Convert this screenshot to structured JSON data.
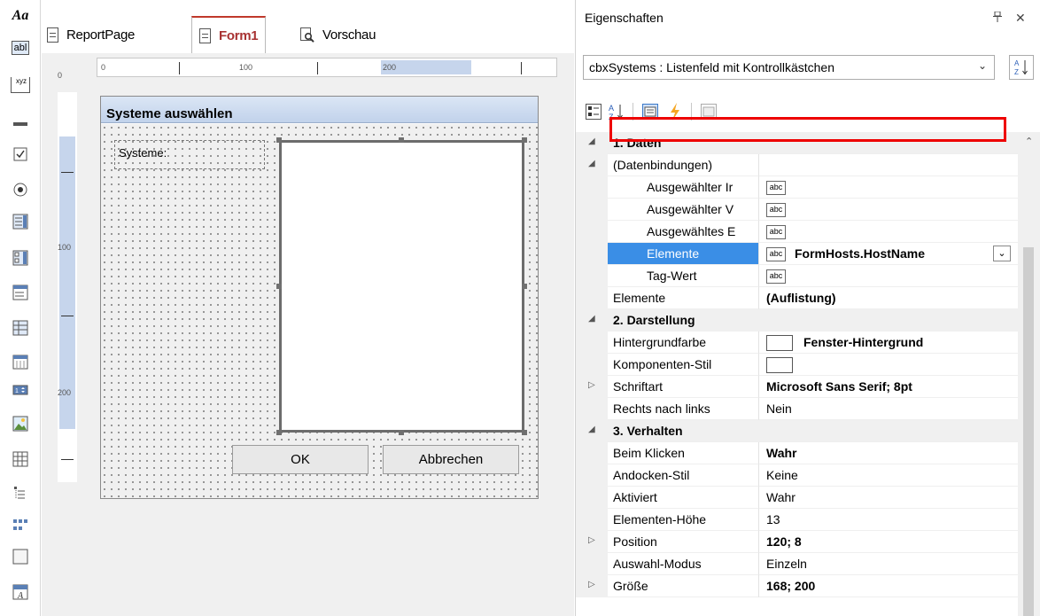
{
  "toolbox": {
    "items": [
      {
        "icon": "font-style-icon",
        "glyph": "Aa"
      },
      {
        "icon": "textbox-icon",
        "glyph": "abl"
      },
      {
        "icon": "masked-textbox-icon",
        "glyph": "xyz"
      },
      {
        "icon": "line-icon"
      },
      {
        "icon": "checkbox-icon"
      },
      {
        "icon": "radio-button-icon"
      },
      {
        "icon": "listbox-icon"
      },
      {
        "icon": "checked-listbox-icon"
      },
      {
        "icon": "combobox-icon"
      },
      {
        "icon": "grid-view-icon"
      },
      {
        "icon": "calendar-icon"
      },
      {
        "icon": "numeric-updown-icon"
      },
      {
        "icon": "picture-icon"
      },
      {
        "icon": "table-icon"
      },
      {
        "icon": "tree-view-icon"
      },
      {
        "icon": "label-group-icon"
      },
      {
        "icon": "panel-icon"
      },
      {
        "icon": "rich-text-icon"
      }
    ]
  },
  "designer": {
    "tabs": [
      {
        "label": "ReportPage",
        "icon": "page-icon"
      },
      {
        "label": "Form1",
        "icon": "page-icon",
        "active": true
      },
      {
        "label": "Vorschau",
        "icon": "preview-icon"
      }
    ],
    "hruler": {
      "labels": [
        "0",
        "100",
        "200"
      ]
    },
    "vruler": {
      "labels": [
        "0",
        "100",
        "200"
      ]
    },
    "form": {
      "title": "Systeme auswählen",
      "label": "Systeme:",
      "ok": "OK",
      "cancel": "Abbrechen"
    }
  },
  "properties": {
    "title": "Eigenschaften",
    "pin_glyph": "ᵖ",
    "close_glyph": "✕",
    "object": "cbxSystems : Listenfeld mit Kontrollkästchen",
    "sort_glyph": "A Z",
    "rows": [
      {
        "type": "cat",
        "label": "1. Daten",
        "expander": "◢"
      },
      {
        "type": "prop",
        "label": "(Datenbindungen)",
        "expander": "◢",
        "value": ""
      },
      {
        "type": "prop",
        "label": "Ausgewählter Ir",
        "indent": true,
        "abc": true,
        "value": ""
      },
      {
        "type": "prop",
        "label": "Ausgewählter V",
        "indent": true,
        "abc": true,
        "value": ""
      },
      {
        "type": "prop",
        "label": "Ausgewähltes E",
        "indent": true,
        "abc": true,
        "value": ""
      },
      {
        "type": "prop",
        "label": "Elemente",
        "indent": true,
        "abc": true,
        "value": "FormHosts.HostName",
        "bold": true,
        "selected": true
      },
      {
        "type": "prop",
        "label": "Tag-Wert",
        "indent": true,
        "abc": true,
        "value": ""
      },
      {
        "type": "prop",
        "label": "Elemente",
        "value": "(Auflistung)",
        "bold": true
      },
      {
        "type": "cat",
        "label": "2. Darstellung",
        "expander": "◢"
      },
      {
        "type": "prop",
        "label": "Hintergrundfarbe",
        "swatch": "#ffffff",
        "value": "Fenster-Hintergrund",
        "bold": true
      },
      {
        "type": "prop",
        "label": "Komponenten-Stil",
        "swatch": "#ffffff",
        "value": ""
      },
      {
        "type": "prop",
        "label": "Schriftart",
        "expander": "▷",
        "value": "Microsoft Sans Serif; 8pt",
        "bold": true
      },
      {
        "type": "prop",
        "label": "Rechts nach links",
        "value": "Nein"
      },
      {
        "type": "cat",
        "label": "3. Verhalten",
        "expander": "◢"
      },
      {
        "type": "prop",
        "label": "Beim Klicken",
        "value": "Wahr",
        "bold": true
      },
      {
        "type": "prop",
        "label": "Andocken-Stil",
        "value": "Keine"
      },
      {
        "type": "prop",
        "label": "Aktiviert",
        "value": "Wahr"
      },
      {
        "type": "prop",
        "label": "Elementen-Höhe",
        "value": "13"
      },
      {
        "type": "prop",
        "label": "Position",
        "expander": "▷",
        "value": "120; 8",
        "bold": true
      },
      {
        "type": "prop",
        "label": "Auswahl-Modus",
        "value": "Einzeln"
      },
      {
        "type": "prop",
        "label": "Größe",
        "expander": "▷",
        "value": "168; 200",
        "bold": true
      }
    ]
  }
}
